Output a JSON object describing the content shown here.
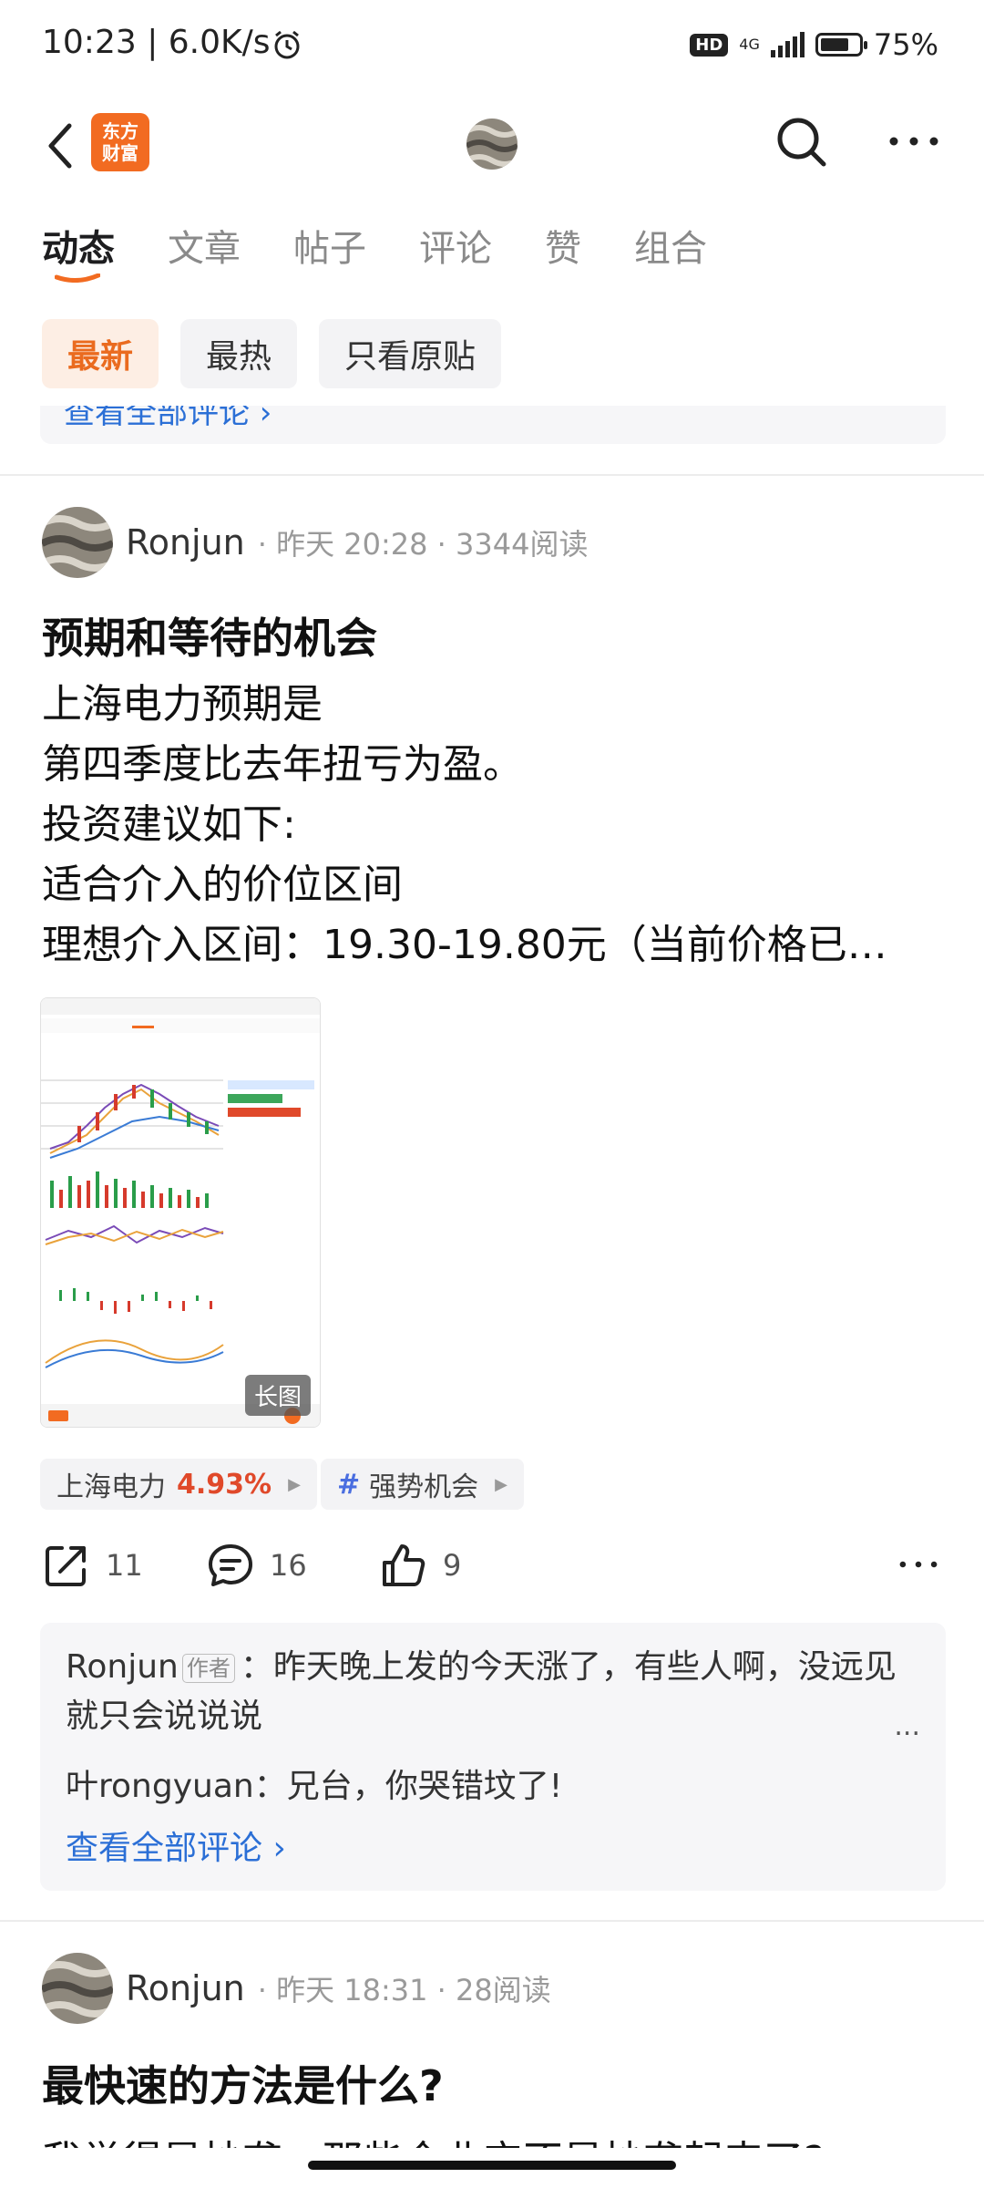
{
  "status_bar": {
    "time_speed": "10:23 | 6.0K/s",
    "hd": "HD",
    "network": "4G",
    "battery": "75%",
    "battery_level": 0.75
  },
  "header": {
    "logo_line1": "东方",
    "logo_line2": "财富",
    "back_icon": "chevron-left-icon",
    "search_icon": "search-icon",
    "more_icon": "more-horizontal-icon"
  },
  "tabs": [
    {
      "label": "动态",
      "active": true
    },
    {
      "label": "文章"
    },
    {
      "label": "帖子"
    },
    {
      "label": "评论"
    },
    {
      "label": "赞"
    },
    {
      "label": "组合"
    }
  ],
  "filters": [
    {
      "label": "最新",
      "active": true
    },
    {
      "label": "最热"
    },
    {
      "label": "只看原贴"
    }
  ],
  "prev_view_all": "查看全部评论 ›",
  "post1": {
    "author": "Ronjun",
    "meta": "· 昨天 20:28 · 3344阅读",
    "title": "预期和等待的机会",
    "lines": [
      "上海电力预期是",
      "第四季度比去年扭亏为盈。",
      "投资建议如下:",
      "适合介入的价位区间",
      "理想介入区间：19.30-19.80元（当前价格已…"
    ],
    "image_badge": "长图",
    "tags": {
      "stock_name": "上海电力",
      "stock_change": "4.93%",
      "topic_hash": "#",
      "topic": "强势机会"
    },
    "actions": {
      "share_count": "11",
      "comment_count": "16",
      "like_count": "9"
    },
    "comments": {
      "c1_author": "Ronjun",
      "c1_author_tag": "作者",
      "c1_text": "：昨天晚上发的今天涨了，有些人啊，没远见就只会说说说",
      "c1_more": "...",
      "c2_author": "叶rongyuan",
      "c2_text": "：兄台，你哭错坟了!",
      "view_all": "查看全部评论 ›"
    }
  },
  "post2": {
    "author": "Ronjun",
    "meta": "· 昨天 18:31 · 28阅读",
    "title": "最快速的方法是什么?",
    "cut_line": "我觉得是抄袭，那些企业它不是抄袭起来了?..."
  }
}
